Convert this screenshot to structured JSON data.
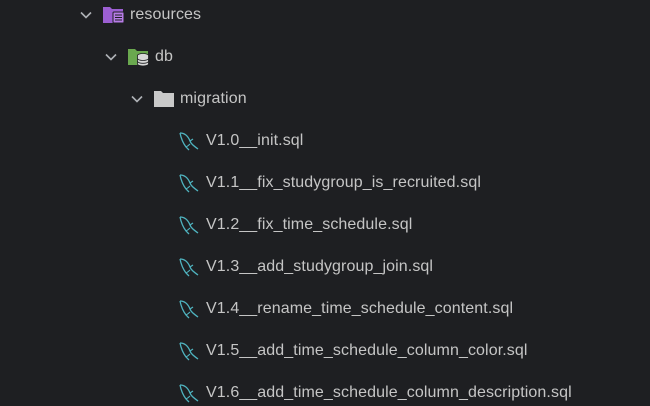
{
  "tree": {
    "resources": {
      "label": "resources",
      "icon": "resources-folder-icon",
      "expanded": true
    },
    "db": {
      "label": "db",
      "icon": "database-folder-icon",
      "expanded": true
    },
    "migration": {
      "label": "migration",
      "icon": "folder-icon",
      "expanded": true
    },
    "files": [
      {
        "label": "V1.0__init.sql",
        "icon": "mysql-dolphin-icon"
      },
      {
        "label": "V1.1__fix_studygroup_is_recruited.sql",
        "icon": "mysql-dolphin-icon"
      },
      {
        "label": "V1.2__fix_time_schedule.sql",
        "icon": "mysql-dolphin-icon"
      },
      {
        "label": "V1.3__add_studygroup_join.sql",
        "icon": "mysql-dolphin-icon"
      },
      {
        "label": "V1.4__rename_time_schedule_content.sql",
        "icon": "mysql-dolphin-icon"
      },
      {
        "label": "V1.5__add_time_schedule_column_color.sql",
        "icon": "mysql-dolphin-icon"
      },
      {
        "label": "V1.6__add_time_schedule_column_description.sql",
        "icon": "mysql-dolphin-icon"
      }
    ]
  },
  "colors": {
    "background": "#1e1f22",
    "text": "#c5c5c5",
    "chevron": "#aeb1b6",
    "resources_folder": "#9c5fd2",
    "db_folder": "#6aa84f",
    "folder": "#c9c9c9",
    "mysql_icon": "#4fb3bf"
  }
}
